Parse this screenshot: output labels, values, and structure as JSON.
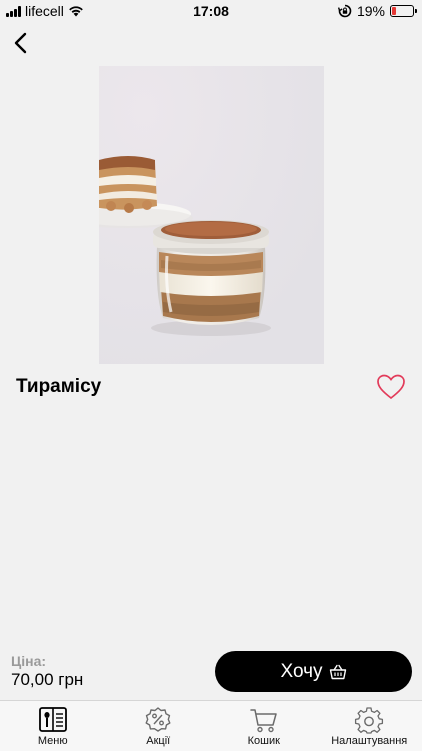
{
  "status_bar": {
    "carrier": "lifecell",
    "time": "17:08",
    "battery": "19%",
    "battery_level": 0.19,
    "battery_color": "#e53935"
  },
  "product": {
    "name": "Тирамісу",
    "image_icon": "tiramisu-photo"
  },
  "price": {
    "label": "Ціна:",
    "value": "70,00 грн"
  },
  "cta": {
    "label": "Хочу"
  },
  "tabbar": {
    "items": [
      {
        "label": "Меню",
        "icon": "menu-book-icon"
      },
      {
        "label": "Акції",
        "icon": "discount-badge-icon"
      },
      {
        "label": "Кошик",
        "icon": "cart-icon"
      },
      {
        "label": "Налаштування",
        "icon": "gear-icon"
      }
    ]
  },
  "colors": {
    "accent": "#000000",
    "favorite": "#e23b5a",
    "background": "#f1f1f1"
  }
}
